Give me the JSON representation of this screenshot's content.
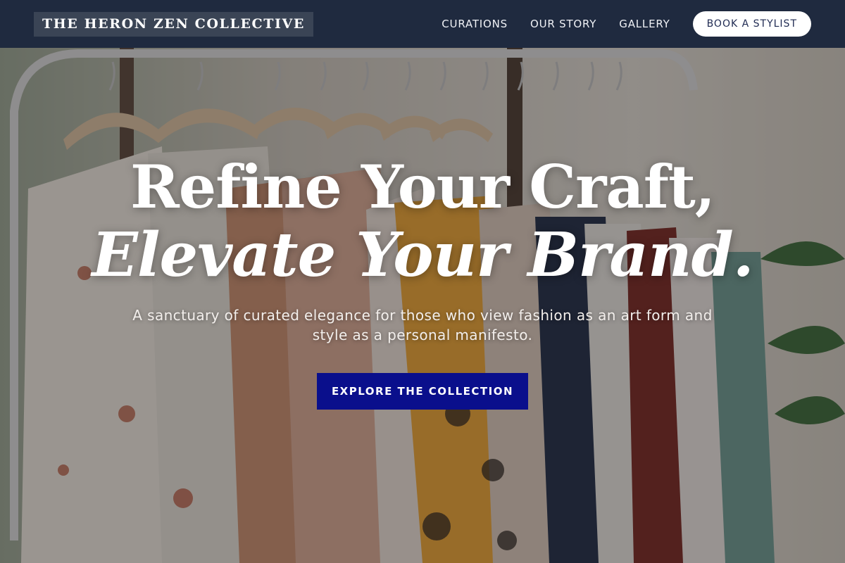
{
  "brand": {
    "name": "THE HERON ZEN COLLECTIVE"
  },
  "nav": {
    "links": [
      "CURATIONS",
      "OUR STORY",
      "GALLERY"
    ],
    "cta_label": "BOOK A STYLIST"
  },
  "hero": {
    "headline_line1": "Refine Your Craft,",
    "headline_line2": "Elevate Your Brand.",
    "subtext": "A sanctuary of curated elegance for those who view fashion as an art form and style as a personal manifesto.",
    "button_label": "EXPLORE THE COLLECTION",
    "image": "clothing-rack-photo"
  },
  "colors": {
    "header_bg": "#1f2a3f",
    "logo_bg": "#3a4455",
    "cta_bg": "#ffffff",
    "primary_button": "#0a0f8c"
  }
}
